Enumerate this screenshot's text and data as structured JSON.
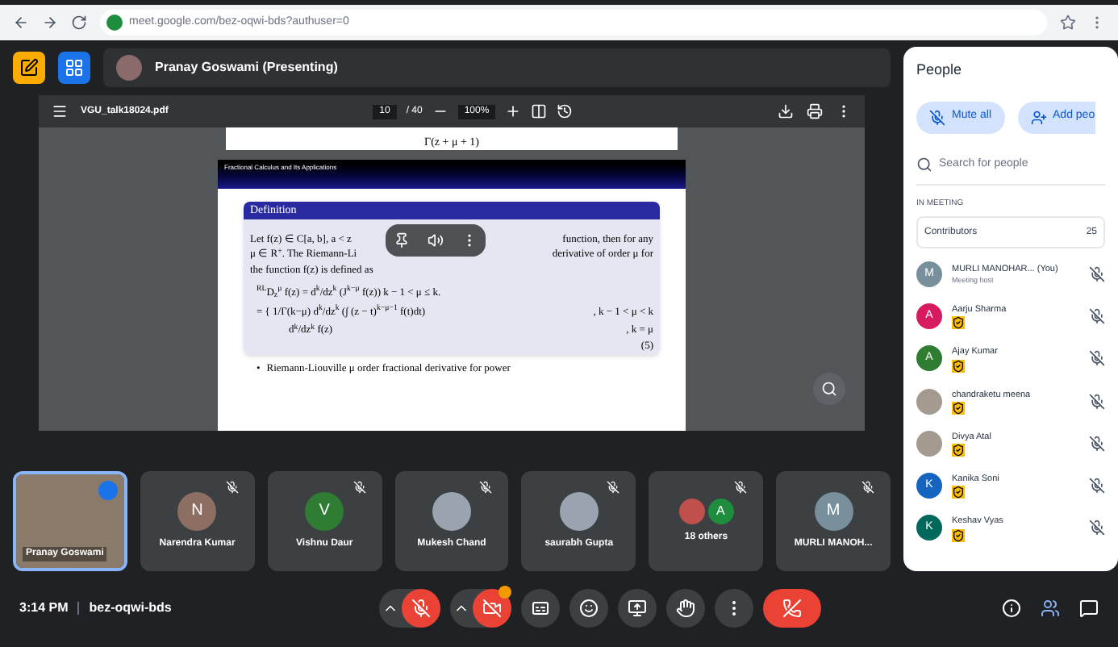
{
  "browser": {
    "url": "meet.google.com/bez-oqwi-bds?authuser=0"
  },
  "presenter": {
    "label": "Pranay Goswami (Presenting)"
  },
  "pdf": {
    "filename": "VGU_talk18024.pdf",
    "page": "10",
    "page_total": "/ 40",
    "zoom": "100%",
    "prev_page_text": "Γ(z + μ + 1)",
    "slide_header": "Fractional Calculus and Its Applications",
    "block_title": "Definition",
    "lines": [
      {
        "left": "Let f(z) ∈ C[a, b], a < z",
        "right": "function, then for any"
      },
      {
        "left": "μ ∈ R$^{+}$. The Riemann-Li",
        "right": "derivative of order μ for"
      },
      {
        "left": "the function f(z) is defined as"
      }
    ],
    "formula_lines": [
      {
        "expr": "$^{RL}$D$_{z}$$^{μ}$ f(z) = d$^{k}$/dz$^{k}$ (J$^{k−μ}$ f(z))  k − 1 < μ ≤ k."
      },
      {
        "expr": "= { 1/Γ(k−μ) d$^{k}$/dz$^{k}$ (∫ (z − t)$^{k−μ−1}$ f(t)dt)",
        "condition": ", k − 1 < μ < k"
      },
      {
        "expr": "d$^{k}$/dz$^{k}$ f(z)",
        "condition": ", k = μ"
      }
    ],
    "equation_number": "(5)",
    "bullet_mark": "•",
    "bullet": "Riemann-Liouville μ order fractional derivative for power"
  },
  "tiles": [
    {
      "kind": "video",
      "name": "Pranay Goswami",
      "selected": true
    },
    {
      "kind": "avatar",
      "name": "Narendra Kumar",
      "initial": "N",
      "color": "#8d6e63",
      "selected": false
    },
    {
      "kind": "avatar",
      "name": "Vishnu Daur",
      "initial": "V",
      "color": "#2e7d32",
      "selected": false
    },
    {
      "kind": "photo",
      "name": "Mukesh Chand",
      "selected": false
    },
    {
      "kind": "photo",
      "name": "saurabh Gupta",
      "selected": false
    },
    {
      "kind": "group",
      "name": "18 others",
      "initial": "A",
      "color": "#1e8e3e",
      "selected": false
    },
    {
      "kind": "avatar",
      "name": "MURLI MANOH...",
      "initial": "M",
      "color": "#78909c",
      "selected": false
    }
  ],
  "meeting": {
    "time": "3:14 PM",
    "code": "bez-oqwi-bds"
  },
  "people": {
    "title": "People",
    "mute_all": "Mute all",
    "add_people": "Add peo",
    "search_placeholder": "Search for people",
    "section": "IN MEETING",
    "group": "Contributors",
    "count": "25",
    "members": [
      {
        "kind": "letter",
        "name": "MURLI MANOHAR... (You)",
        "subtitle": "Meeting host",
        "initial": "M",
        "color": "#78909c"
      },
      {
        "kind": "letter",
        "name": "Aarju Sharma",
        "initial": "A",
        "color": "#d81b60"
      },
      {
        "kind": "letter",
        "name": "Ajay Kumar",
        "initial": "A",
        "color": "#2e7d32"
      },
      {
        "kind": "photo",
        "name": "chandraketu meena"
      },
      {
        "kind": "photo",
        "name": "Divya Atal"
      },
      {
        "kind": "letter",
        "name": "Kanika Soni",
        "initial": "K",
        "color": "#1565c0"
      },
      {
        "kind": "letter",
        "name": "Keshav Vyas",
        "initial": "K",
        "color": "#00695c"
      }
    ]
  }
}
